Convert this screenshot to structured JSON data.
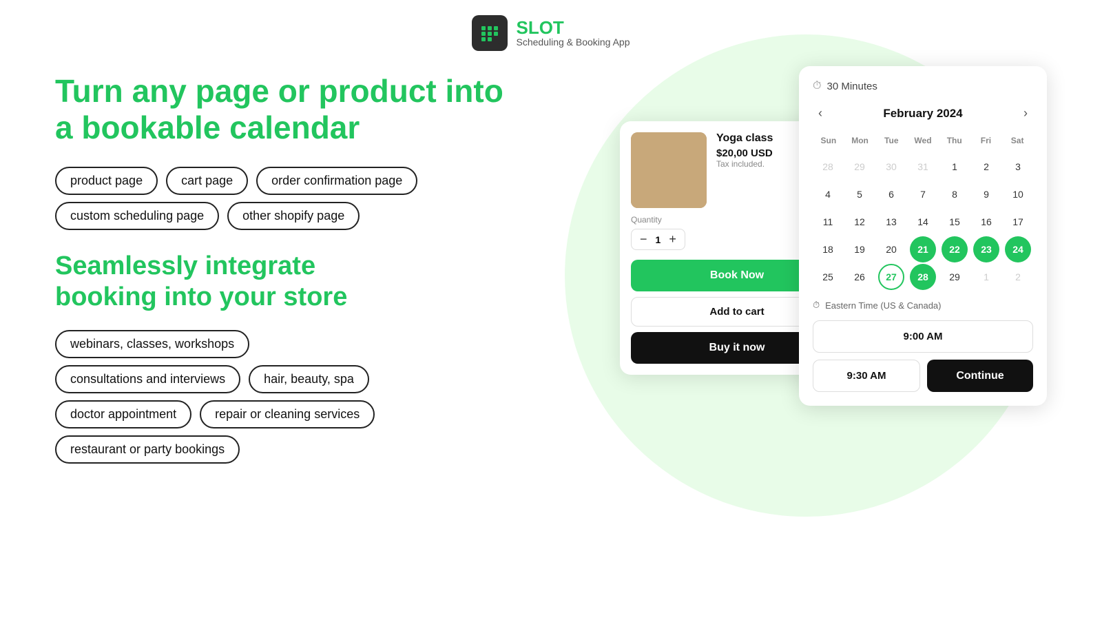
{
  "app": {
    "name": "SLOT",
    "subtitle": "Scheduling & Booking App"
  },
  "hero": {
    "headline": "Turn any page or product into\na bookable calendar",
    "tags_row1": [
      "product page",
      "cart page",
      "order confirmation page"
    ],
    "tags_row2": [
      "custom scheduling page",
      "other shopify page"
    ],
    "sub_headline": "Seamlessly integrate\nbooking into your store",
    "use_cases_row1": [
      "webinars, classes, workshops"
    ],
    "use_cases_row2": [
      "consultations and interviews",
      "hair, beauty, spa"
    ],
    "use_cases_row3": [
      "doctor appointment",
      "repair or cleaning services"
    ],
    "use_cases_row4": [
      "restaurant or party bookings"
    ]
  },
  "product_card": {
    "name": "Yoga class",
    "price": "$20,00 USD",
    "tax": "Tax included.",
    "quantity_label": "Quantity",
    "quantity_value": "1",
    "qty_minus": "−",
    "qty_plus": "+",
    "book_btn": "Book Now",
    "add_cart_btn": "Add to cart",
    "buy_btn": "Buy it now"
  },
  "calendar": {
    "duration": "30 Minutes",
    "month": "February 2024",
    "timezone": "Eastern Time (US & Canada)",
    "headers": [
      "Sun",
      "Mon",
      "Tue",
      "Wed",
      "Thu",
      "Fri",
      "Sat"
    ],
    "weeks": [
      [
        {
          "day": "28",
          "other": true
        },
        {
          "day": "29",
          "other": true
        },
        {
          "day": "30",
          "other": true
        },
        {
          "day": "31",
          "other": true
        },
        {
          "day": "1"
        },
        {
          "day": "2"
        },
        {
          "day": "3"
        }
      ],
      [
        {
          "day": "4"
        },
        {
          "day": "5"
        },
        {
          "day": "6"
        },
        {
          "day": "7"
        },
        {
          "day": "8"
        },
        {
          "day": "9"
        },
        {
          "day": "10"
        }
      ],
      [
        {
          "day": "11"
        },
        {
          "day": "12"
        },
        {
          "day": "13"
        },
        {
          "day": "14"
        },
        {
          "day": "15"
        },
        {
          "day": "16"
        },
        {
          "day": "17"
        }
      ],
      [
        {
          "day": "18"
        },
        {
          "day": "19"
        },
        {
          "day": "20"
        },
        {
          "day": "21",
          "hl": true
        },
        {
          "day": "22",
          "hl": true
        },
        {
          "day": "23",
          "hl": true
        },
        {
          "day": "24",
          "hl": true
        }
      ],
      [
        {
          "day": "25"
        },
        {
          "day": "26"
        },
        {
          "day": "27",
          "hl_outline": true
        },
        {
          "day": "28",
          "hl": true
        },
        {
          "day": "29"
        },
        {
          "day": "1",
          "other": true
        },
        {
          "day": "2",
          "other": true
        }
      ]
    ],
    "time_slot_1": "9:00 AM",
    "time_slot_2": "9:30 AM",
    "continue_btn": "Continue",
    "prev_btn": "‹",
    "next_btn": "›"
  }
}
